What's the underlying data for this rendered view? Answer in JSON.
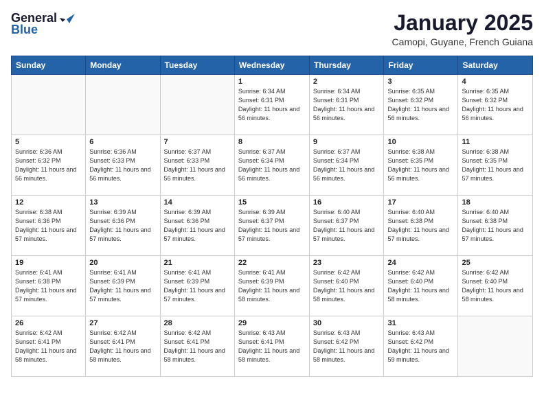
{
  "header": {
    "logo_general": "General",
    "logo_blue": "Blue",
    "month_title": "January 2025",
    "location": "Camopi, Guyane, French Guiana"
  },
  "weekdays": [
    "Sunday",
    "Monday",
    "Tuesday",
    "Wednesday",
    "Thursday",
    "Friday",
    "Saturday"
  ],
  "weeks": [
    [
      {
        "day": "",
        "info": ""
      },
      {
        "day": "",
        "info": ""
      },
      {
        "day": "",
        "info": ""
      },
      {
        "day": "1",
        "info": "Sunrise: 6:34 AM\nSunset: 6:31 PM\nDaylight: 11 hours\nand 56 minutes."
      },
      {
        "day": "2",
        "info": "Sunrise: 6:34 AM\nSunset: 6:31 PM\nDaylight: 11 hours\nand 56 minutes."
      },
      {
        "day": "3",
        "info": "Sunrise: 6:35 AM\nSunset: 6:32 PM\nDaylight: 11 hours\nand 56 minutes."
      },
      {
        "day": "4",
        "info": "Sunrise: 6:35 AM\nSunset: 6:32 PM\nDaylight: 11 hours\nand 56 minutes."
      }
    ],
    [
      {
        "day": "5",
        "info": "Sunrise: 6:36 AM\nSunset: 6:32 PM\nDaylight: 11 hours\nand 56 minutes."
      },
      {
        "day": "6",
        "info": "Sunrise: 6:36 AM\nSunset: 6:33 PM\nDaylight: 11 hours\nand 56 minutes."
      },
      {
        "day": "7",
        "info": "Sunrise: 6:37 AM\nSunset: 6:33 PM\nDaylight: 11 hours\nand 56 minutes."
      },
      {
        "day": "8",
        "info": "Sunrise: 6:37 AM\nSunset: 6:34 PM\nDaylight: 11 hours\nand 56 minutes."
      },
      {
        "day": "9",
        "info": "Sunrise: 6:37 AM\nSunset: 6:34 PM\nDaylight: 11 hours\nand 56 minutes."
      },
      {
        "day": "10",
        "info": "Sunrise: 6:38 AM\nSunset: 6:35 PM\nDaylight: 11 hours\nand 56 minutes."
      },
      {
        "day": "11",
        "info": "Sunrise: 6:38 AM\nSunset: 6:35 PM\nDaylight: 11 hours\nand 57 minutes."
      }
    ],
    [
      {
        "day": "12",
        "info": "Sunrise: 6:38 AM\nSunset: 6:36 PM\nDaylight: 11 hours\nand 57 minutes."
      },
      {
        "day": "13",
        "info": "Sunrise: 6:39 AM\nSunset: 6:36 PM\nDaylight: 11 hours\nand 57 minutes."
      },
      {
        "day": "14",
        "info": "Sunrise: 6:39 AM\nSunset: 6:36 PM\nDaylight: 11 hours\nand 57 minutes."
      },
      {
        "day": "15",
        "info": "Sunrise: 6:39 AM\nSunset: 6:37 PM\nDaylight: 11 hours\nand 57 minutes."
      },
      {
        "day": "16",
        "info": "Sunrise: 6:40 AM\nSunset: 6:37 PM\nDaylight: 11 hours\nand 57 minutes."
      },
      {
        "day": "17",
        "info": "Sunrise: 6:40 AM\nSunset: 6:38 PM\nDaylight: 11 hours\nand 57 minutes."
      },
      {
        "day": "18",
        "info": "Sunrise: 6:40 AM\nSunset: 6:38 PM\nDaylight: 11 hours\nand 57 minutes."
      }
    ],
    [
      {
        "day": "19",
        "info": "Sunrise: 6:41 AM\nSunset: 6:38 PM\nDaylight: 11 hours\nand 57 minutes."
      },
      {
        "day": "20",
        "info": "Sunrise: 6:41 AM\nSunset: 6:39 PM\nDaylight: 11 hours\nand 57 minutes."
      },
      {
        "day": "21",
        "info": "Sunrise: 6:41 AM\nSunset: 6:39 PM\nDaylight: 11 hours\nand 57 minutes."
      },
      {
        "day": "22",
        "info": "Sunrise: 6:41 AM\nSunset: 6:39 PM\nDaylight: 11 hours\nand 58 minutes."
      },
      {
        "day": "23",
        "info": "Sunrise: 6:42 AM\nSunset: 6:40 PM\nDaylight: 11 hours\nand 58 minutes."
      },
      {
        "day": "24",
        "info": "Sunrise: 6:42 AM\nSunset: 6:40 PM\nDaylight: 11 hours\nand 58 minutes."
      },
      {
        "day": "25",
        "info": "Sunrise: 6:42 AM\nSunset: 6:40 PM\nDaylight: 11 hours\nand 58 minutes."
      }
    ],
    [
      {
        "day": "26",
        "info": "Sunrise: 6:42 AM\nSunset: 6:41 PM\nDaylight: 11 hours\nand 58 minutes."
      },
      {
        "day": "27",
        "info": "Sunrise: 6:42 AM\nSunset: 6:41 PM\nDaylight: 11 hours\nand 58 minutes."
      },
      {
        "day": "28",
        "info": "Sunrise: 6:42 AM\nSunset: 6:41 PM\nDaylight: 11 hours\nand 58 minutes."
      },
      {
        "day": "29",
        "info": "Sunrise: 6:43 AM\nSunset: 6:41 PM\nDaylight: 11 hours\nand 58 minutes."
      },
      {
        "day": "30",
        "info": "Sunrise: 6:43 AM\nSunset: 6:42 PM\nDaylight: 11 hours\nand 58 minutes."
      },
      {
        "day": "31",
        "info": "Sunrise: 6:43 AM\nSunset: 6:42 PM\nDaylight: 11 hours\nand 59 minutes."
      },
      {
        "day": "",
        "info": ""
      }
    ]
  ]
}
